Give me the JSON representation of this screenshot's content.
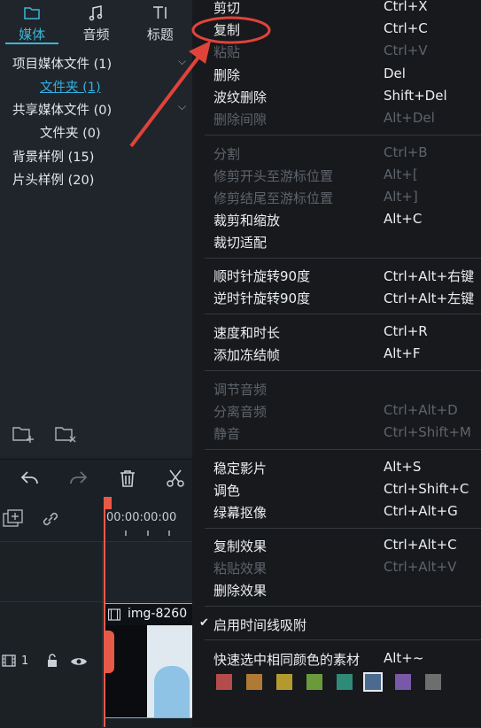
{
  "tabs": [
    {
      "label": "媒体",
      "icon": "folder-icon"
    },
    {
      "label": "音频",
      "icon": "music-note-icon"
    },
    {
      "label": "标题",
      "icon": "text-title-icon"
    }
  ],
  "tree": [
    {
      "label": "项目媒体文件 (1)"
    },
    {
      "label": "文件夹 (1)"
    },
    {
      "label": "共享媒体文件 (0)"
    },
    {
      "label": "文件夹 (0)"
    },
    {
      "label": "背景样例 (15)"
    },
    {
      "label": "片头样例 (20)"
    }
  ],
  "timeline": {
    "timecode": "00:00:00:00",
    "track_number": "1",
    "clip_name": "img-8260"
  },
  "menu": {
    "items": [
      {
        "label": "剪切",
        "shortcut": "Ctrl+X",
        "enabled": true
      },
      {
        "label": "复制",
        "shortcut": "Ctrl+C",
        "enabled": true
      },
      {
        "label": "粘贴",
        "shortcut": "Ctrl+V",
        "enabled": false
      },
      {
        "label": "删除",
        "shortcut": "Del",
        "enabled": true
      },
      {
        "label": "波纹删除",
        "shortcut": "Shift+Del",
        "enabled": true
      },
      {
        "label": "删除间隙",
        "shortcut": "Alt+Del",
        "enabled": false
      },
      {
        "label": "分割",
        "shortcut": "Ctrl+B",
        "enabled": false
      },
      {
        "label": "修剪开头至游标位置",
        "shortcut": "Alt+[",
        "enabled": false
      },
      {
        "label": "修剪结尾至游标位置",
        "shortcut": "Alt+]",
        "enabled": false
      },
      {
        "label": "裁剪和缩放",
        "shortcut": "Alt+C",
        "enabled": true
      },
      {
        "label": "裁切适配",
        "shortcut": "",
        "enabled": true
      },
      {
        "label": "顺时针旋转90度",
        "shortcut": "Ctrl+Alt+右键",
        "enabled": true
      },
      {
        "label": "逆时针旋转90度",
        "shortcut": "Ctrl+Alt+左键",
        "enabled": true
      },
      {
        "label": "速度和时长",
        "shortcut": "Ctrl+R",
        "enabled": true
      },
      {
        "label": "添加冻结帧",
        "shortcut": "Alt+F",
        "enabled": true
      },
      {
        "label": "调节音频",
        "shortcut": "",
        "enabled": false
      },
      {
        "label": "分离音频",
        "shortcut": "Ctrl+Alt+D",
        "enabled": false
      },
      {
        "label": "静音",
        "shortcut": "Ctrl+Shift+M",
        "enabled": false
      },
      {
        "label": "稳定影片",
        "shortcut": "Alt+S",
        "enabled": true
      },
      {
        "label": "调色",
        "shortcut": "Ctrl+Shift+C",
        "enabled": true
      },
      {
        "label": "绿幕抠像",
        "shortcut": "Ctrl+Alt+G",
        "enabled": true
      },
      {
        "label": "复制效果",
        "shortcut": "Ctrl+Alt+C",
        "enabled": true
      },
      {
        "label": "粘贴效果",
        "shortcut": "Ctrl+Alt+V",
        "enabled": false
      },
      {
        "label": "删除效果",
        "shortcut": "",
        "enabled": true
      },
      {
        "label": "启用时间线吸附",
        "shortcut": "",
        "enabled": true,
        "checked": true
      },
      {
        "label": "快速选中相同颜色的素材",
        "shortcut": "Alt+~",
        "enabled": true
      }
    ],
    "color_swatches": [
      "#b54c4c",
      "#b07a34",
      "#b49a2e",
      "#6a9a3a",
      "#2f8a78",
      "#4a6a90",
      "#7a58a8",
      "#6e6e6e"
    ]
  },
  "colors": {
    "accent": "#3db6d9",
    "annotation": "#e0433a",
    "playhead": "#e85a48"
  }
}
